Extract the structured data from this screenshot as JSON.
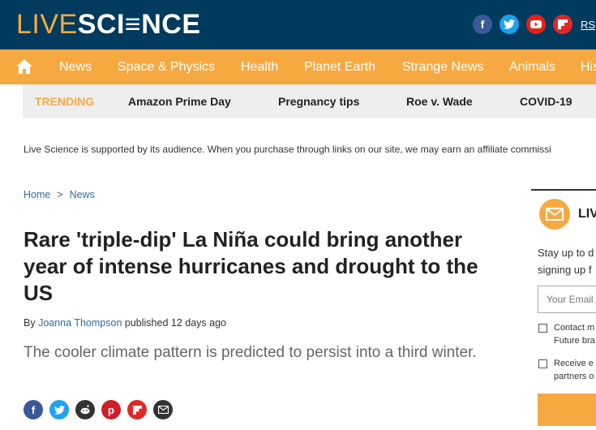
{
  "header": {
    "logo_live": "LIVE",
    "logo_science": "SCI≡NCE",
    "social": [
      {
        "icon": "facebook-icon",
        "glyph": "f",
        "color": "#3b5998"
      },
      {
        "icon": "twitter-icon",
        "glyph": "•",
        "color": "#1da1f2"
      },
      {
        "icon": "youtube-icon",
        "glyph": "▶",
        "color": "#e62117"
      },
      {
        "icon": "flipboard-icon",
        "glyph": "f",
        "color": "#e12828"
      }
    ],
    "rss_label": "RS"
  },
  "nav": {
    "home_icon": "home-icon",
    "items": [
      "News",
      "Space & Physics",
      "Health",
      "Planet Earth",
      "Strange News",
      "Animals",
      "His"
    ]
  },
  "trending": {
    "label": "TRENDING",
    "items": [
      "Amazon Prime Day",
      "Pregnancy tips",
      "Roe v. Wade",
      "COVID-19"
    ]
  },
  "affiliate_notice": "Live Science is supported by its audience. When you purchase through links on our site, we may earn an affiliate commissi",
  "breadcrumb": {
    "items": [
      "Home",
      "News"
    ],
    "separator": ">"
  },
  "article": {
    "title": "Rare 'triple-dip' La Niña could bring another year of intense hurricanes and drought to the US",
    "by": "By",
    "author": "Joanna Thompson",
    "published": "published 12 days ago",
    "subtitle": "The cooler climate pattern is predicted to persist into a third winter."
  },
  "share": [
    {
      "icon": "facebook-share-icon",
      "glyph": "f",
      "color": "#3b5998"
    },
    {
      "icon": "twitter-share-icon",
      "glyph": "t",
      "color": "#1da1f2"
    },
    {
      "icon": "reddit-share-icon",
      "glyph": "r",
      "color": "#333333"
    },
    {
      "icon": "pinterest-share-icon",
      "glyph": "p",
      "color": "#cb2027"
    },
    {
      "icon": "flipboard-share-icon",
      "glyph": "f",
      "color": "#e12828"
    },
    {
      "icon": "email-share-icon",
      "glyph": "✉",
      "color": "#333333"
    }
  ],
  "newsletter": {
    "icon": "envelope-icon",
    "heading": "LIV",
    "desc_line1": "Stay up to d",
    "desc_line2": "signing up f",
    "email_placeholder": "Your Email A",
    "consent1_line1": "Contact m",
    "consent1_line2": "Future bra",
    "consent2_line1": "Receive e",
    "consent2_line2": "partners o"
  },
  "colors": {
    "brand_dark": "#003a5d",
    "brand_orange": "#f7a941",
    "link_blue": "#2f6ca2"
  }
}
